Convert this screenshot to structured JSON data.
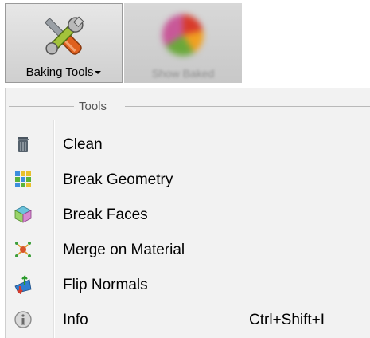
{
  "ribbon": {
    "baking_tools_label": "Baking Tools",
    "show_baked_label": "Show Baked"
  },
  "menu": {
    "section_title": "Tools",
    "items": [
      {
        "label": "Clean",
        "icon": "trash-icon",
        "shortcut": ""
      },
      {
        "label": "Break Geometry",
        "icon": "break-geometry-icon",
        "shortcut": ""
      },
      {
        "label": "Break Faces",
        "icon": "break-faces-icon",
        "shortcut": ""
      },
      {
        "label": "Merge on Material",
        "icon": "merge-material-icon",
        "shortcut": ""
      },
      {
        "label": "Flip Normals",
        "icon": "flip-normals-icon",
        "shortcut": ""
      },
      {
        "label": "Info",
        "icon": "info-icon",
        "shortcut": "Ctrl+Shift+I"
      }
    ]
  }
}
